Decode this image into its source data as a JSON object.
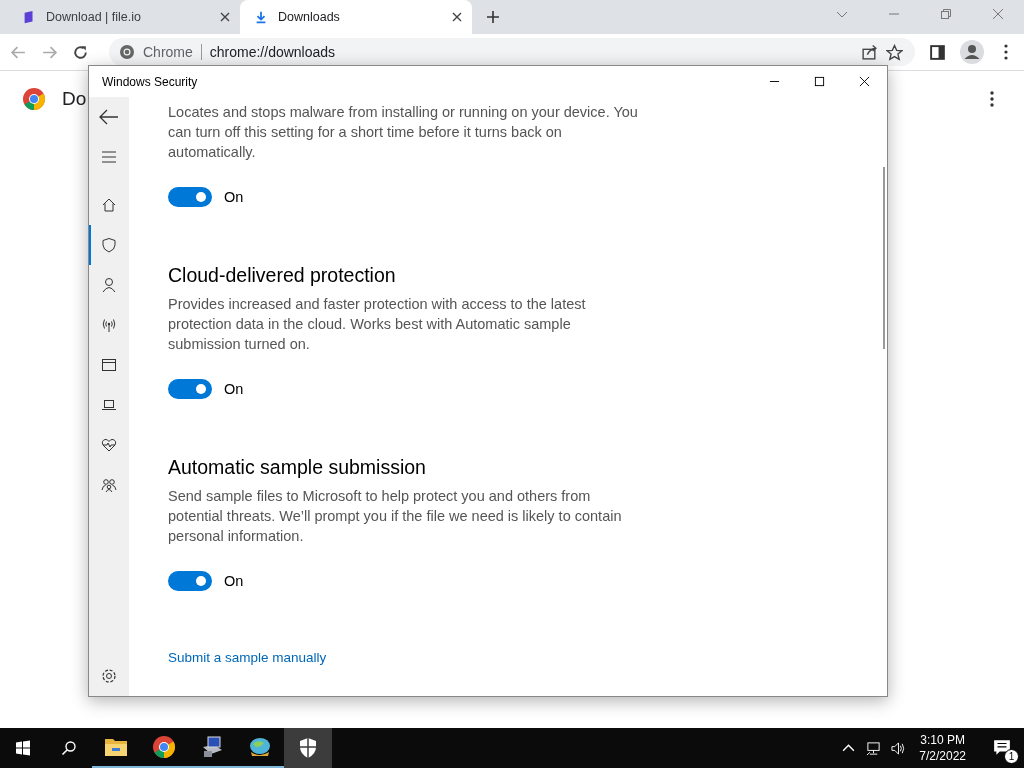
{
  "browser": {
    "tabs": [
      {
        "title": "Download | file.io",
        "kind": "fileio",
        "selected": false
      },
      {
        "title": "Downloads",
        "kind": "download",
        "selected": true
      }
    ],
    "omnibox": {
      "site": "Chrome",
      "url": "chrome://downloads"
    },
    "page": {
      "heading": "Do"
    }
  },
  "dialog": {
    "title": "Windows Security",
    "nav": [
      {
        "kind": "home",
        "selected": false
      },
      {
        "kind": "shield",
        "selected": true
      },
      {
        "kind": "person",
        "selected": false
      },
      {
        "kind": "wireless",
        "selected": false
      },
      {
        "kind": "window",
        "selected": false
      },
      {
        "kind": "laptop",
        "selected": false
      },
      {
        "kind": "heart",
        "selected": false
      },
      {
        "kind": "family",
        "selected": false
      }
    ],
    "sections": [
      {
        "description": "Locates and stops malware from installing or running on your device. You can turn off this setting for a short time before it turns back on automatically.",
        "toggle": {
          "on": true,
          "label": "On"
        }
      },
      {
        "title": "Cloud-delivered protection",
        "description": "Provides increased and faster protection with access to the latest protection data in the cloud. Works best with Automatic sample submission turned on.",
        "toggle": {
          "on": true,
          "label": "On"
        }
      },
      {
        "title": "Automatic sample submission",
        "description": "Send sample files to Microsoft to help protect you and others from potential threats. We’ll prompt you if the file we need is likely to contain personal information.",
        "toggle": {
          "on": true,
          "label": "On"
        }
      }
    ],
    "link": "Submit a sample manually"
  },
  "taskbar": {
    "apps": [
      {
        "kind": "explorer",
        "running": true,
        "selected": false
      },
      {
        "kind": "chrome",
        "running": true,
        "selected": false
      },
      {
        "kind": "computer",
        "running": true,
        "selected": false
      },
      {
        "kind": "globe",
        "running": true,
        "selected": false
      },
      {
        "kind": "shield",
        "running": false,
        "selected": true
      }
    ],
    "time": "3:10 PM",
    "date": "7/2/2022",
    "notifications": "1"
  }
}
